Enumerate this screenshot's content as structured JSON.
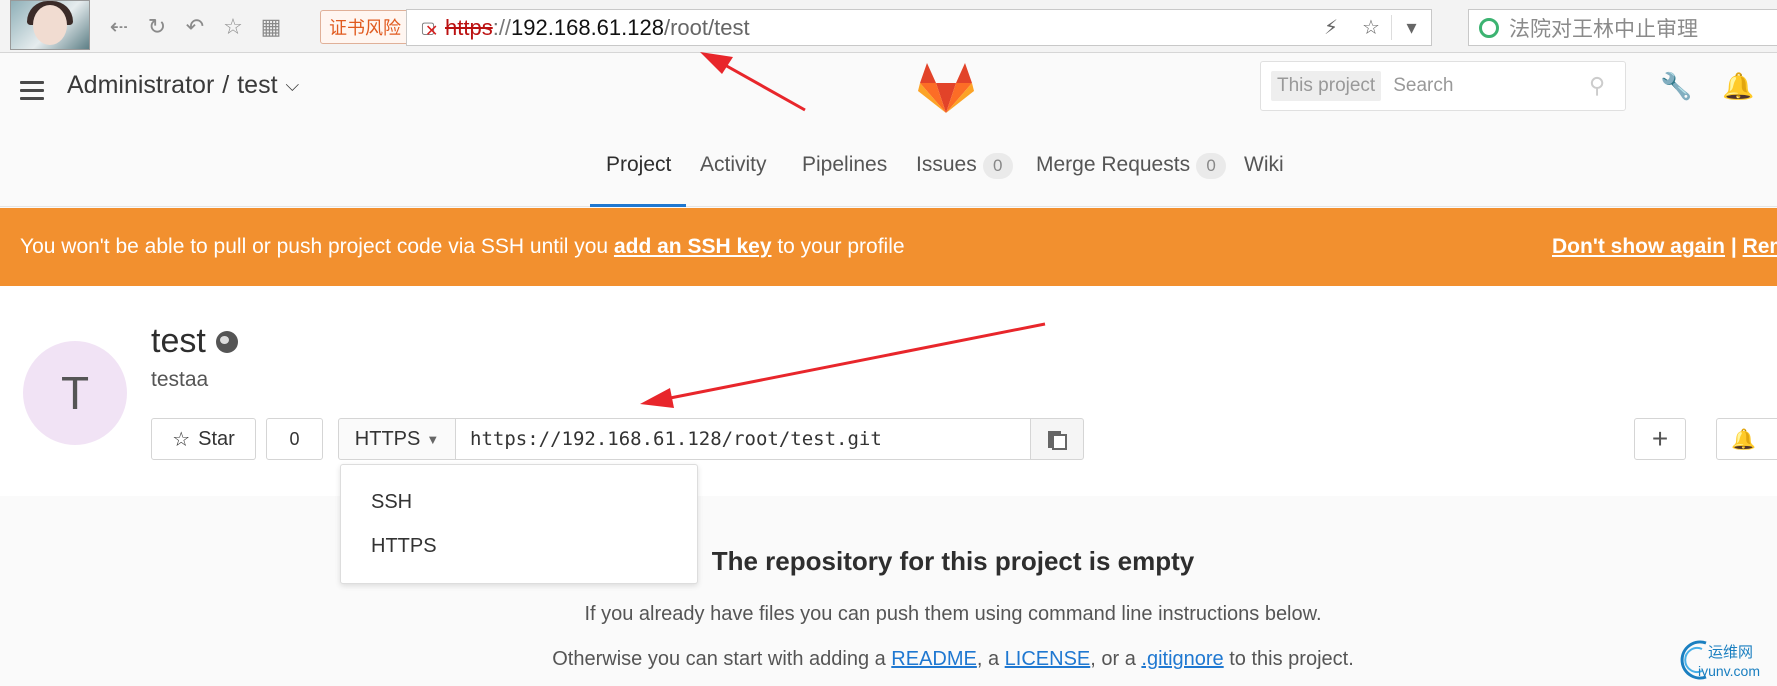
{
  "browser": {
    "cert_warning": "证书风险",
    "url_protocol": "https",
    "url_separator": "://",
    "url_host": "192.168.61.128",
    "url_path": "/root/test",
    "search_hint": "法院对王林中止审理"
  },
  "header": {
    "breadcrumb_owner": "Administrator",
    "breadcrumb_sep": "/",
    "breadcrumb_project": "test",
    "search_scope": "This project",
    "search_placeholder": "Search"
  },
  "tabs": [
    {
      "label": "Project",
      "badge": ""
    },
    {
      "label": "Activity",
      "badge": ""
    },
    {
      "label": "Pipelines",
      "badge": ""
    },
    {
      "label": "Issues",
      "badge": "0"
    },
    {
      "label": "Merge Requests",
      "badge": "0"
    },
    {
      "label": "Wiki",
      "badge": ""
    }
  ],
  "alert": {
    "text_before": "You won't be able to pull or push project code via SSH until you ",
    "link": "add an SSH key",
    "text_after": " to your profile",
    "dont_show": "Don't show again",
    "divider": "|",
    "remind": "Rem"
  },
  "project": {
    "avatar_letter": "T",
    "name": "test",
    "description": "testaa",
    "star_label": "Star",
    "star_count": "0",
    "protocol": "HTTPS",
    "clone_url": "https://192.168.61.128/root/test.git"
  },
  "dropdown": {
    "options": [
      "SSH",
      "HTTPS"
    ]
  },
  "empty": {
    "title": "The repository for this project is empty",
    "line1": "If you already have files you can push them using command line instructions below.",
    "line2_before": "Otherwise you can start with adding a ",
    "readme": "README",
    "comma1": ", a ",
    "license": "LICENSE",
    "comma2": ", or a ",
    "gitignore": ".gitignore",
    "line2_after": " to this project."
  },
  "watermark": {
    "cn": "运维网",
    "en": "iyunv.com"
  },
  "colors": {
    "alert": "#f2902f",
    "active_tab": "#1f78d1",
    "link": "#1f78d1",
    "annotation_arrow": "#e8262b"
  }
}
